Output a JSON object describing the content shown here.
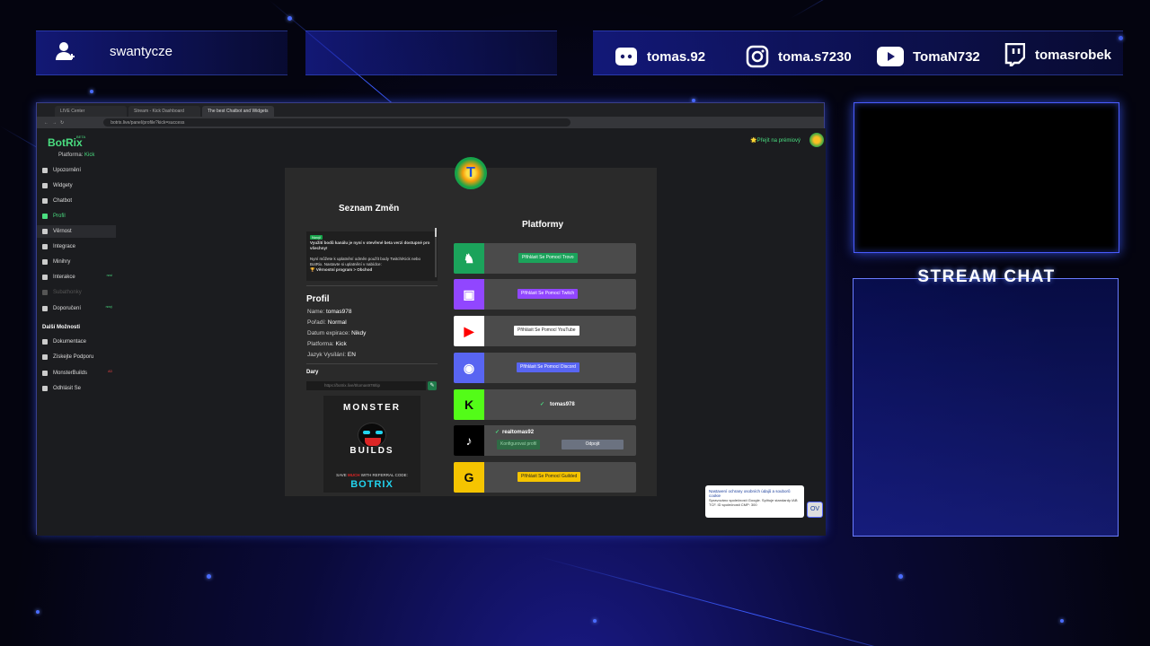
{
  "overlay": {
    "username": "swantycze",
    "socials": [
      {
        "icon": "discord-icon",
        "handle": "tomas.92"
      },
      {
        "icon": "instagram-icon",
        "handle": "toma.s7230"
      },
      {
        "icon": "youtube-icon",
        "handle": "TomaN732"
      },
      {
        "icon": "twitch-icon",
        "handle": "tomasrobek"
      }
    ],
    "chat_title": "STREAM CHAT"
  },
  "browser": {
    "tabs": [
      "LIVE Center",
      "Stream - Kick Dashboard",
      "The best Chatbot and Widgets"
    ],
    "url": "botrix.live/panel/profile?kick=success"
  },
  "app": {
    "logo": "BotRix",
    "beta": "BETA",
    "platform_label": "Platforma:",
    "platform_value": "Kick",
    "premium_link": "🌟Přejít na prémiový",
    "nav": [
      {
        "label": "Upozornění",
        "icon": "warning-icon"
      },
      {
        "label": "Widgety",
        "icon": "widgets-icon"
      },
      {
        "label": "Chatbot",
        "icon": "chatbot-icon"
      },
      {
        "label": "Profil",
        "icon": "profile-icon"
      },
      {
        "label": "Věrnost",
        "icon": "loyalty-icon"
      },
      {
        "label": "Integrace",
        "icon": "integration-icon"
      },
      {
        "label": "Minihry",
        "icon": "games-icon"
      },
      {
        "label": "Interakce",
        "icon": "interaction-icon",
        "tag": "novi"
      },
      {
        "label": "Subathonky",
        "icon": "subathon-icon"
      },
      {
        "label": "Doporučení",
        "icon": "referral-icon",
        "tag": "nový"
      }
    ],
    "more_section": "Další Možnosti",
    "more_nav": [
      {
        "label": "Dokumentace",
        "icon": "docs-icon"
      },
      {
        "label": "Získejte Podporu",
        "icon": "support-icon"
      },
      {
        "label": "MonsterBuilds",
        "icon": "monitor-icon",
        "tag": "AD"
      },
      {
        "label": "Odhlásit Se",
        "icon": "logout-icon"
      }
    ]
  },
  "panel": {
    "changelog_title": "Seznam Změn",
    "changelog": {
      "badge": "Nový!",
      "headline": "Využití bodů kanálu je nyní v otevřené beta verzi dostupné pro všechny!",
      "body": "Nyní můžete k uplatnění odměn použít body Twitch/Kick nebo BotRix. Nastavte si uplatnění v nabídce:",
      "path": "🏆 Věrnostní program > Obchod"
    },
    "profile_title": "Profil",
    "profile": [
      {
        "label": "Name:",
        "value": "tomas978"
      },
      {
        "label": "Pořadí:",
        "value": "Normal"
      },
      {
        "label": "Datum expirace:",
        "value": "Nikdy"
      },
      {
        "label": "Platforma:",
        "value": "Kick"
      },
      {
        "label": "Jazyk Vysílání:",
        "value": "EN"
      }
    ],
    "donations_title": "Dary",
    "ref_link": "https://botrix.live/t/tomas978/tip",
    "ad": {
      "top": "MONSTER",
      "bottom": "BUILDS",
      "small_a": "SAVE",
      "small_b": "MUCH",
      "small_c": "WITH REFERRAL CODE:",
      "code": "BOTRIX"
    },
    "platforms_title": "Platformy",
    "platforms": [
      {
        "name": "trovo",
        "icon": "trovo-icon",
        "action": "Přihlásit Se Pomocí Trovo",
        "color": "#1ba35b",
        "btn": "#1ba35b"
      },
      {
        "name": "twitch",
        "icon": "twitch-icon",
        "action": "Přihlásit Se Pomocí Twitch",
        "color": "#9146ff",
        "btn": "#9146ff"
      },
      {
        "name": "youtube",
        "icon": "youtube-icon",
        "action": "Přihlásit Se Pomocí YouTube",
        "color": "#ffffff",
        "btn": "#ffffff"
      },
      {
        "name": "discord",
        "icon": "discord-icon",
        "action": "Přihlásit Se Pomocí Discord",
        "color": "#5865f2",
        "btn": "#5865f2"
      },
      {
        "name": "kick",
        "icon": "kick-icon",
        "connected": "tomas978",
        "color": "#53fc18"
      },
      {
        "name": "tiktok",
        "icon": "tiktok-icon",
        "connected": "realtomas92",
        "configure": "Konfigurovat profil",
        "disconnect": "Odpojit",
        "color": "#000000"
      },
      {
        "name": "guilded",
        "icon": "guilded-icon",
        "action": "Přihlásit Se Pomocí Guilded",
        "color": "#f5c400",
        "btn": "#f5c400"
      }
    ]
  },
  "cookie": {
    "title": "Nastavení ochrany osobních údajů a souborů cookie",
    "body": "Spravováno společností Google. Splňuje standardy IAB TCF. ID společnosti CMP: 300",
    "button": "OV"
  }
}
